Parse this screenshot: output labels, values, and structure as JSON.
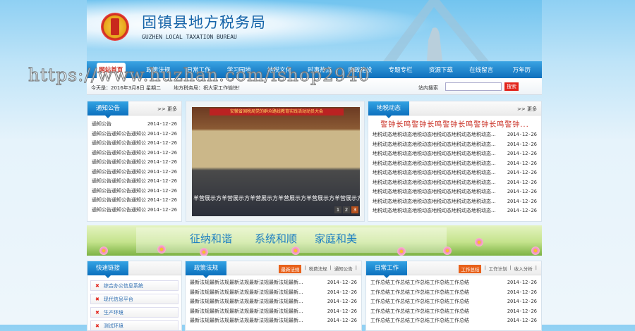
{
  "header": {
    "title": "固镇县地方税务局",
    "subtitle": "GUZHEN LOCAL TAXATION BUREAU"
  },
  "nav": [
    "网站首页",
    "政策法规",
    "日常工作",
    "学习园地",
    "地税文化",
    "时事热点",
    "廉政建设",
    "专题专栏",
    "资源下载",
    "在线留言",
    "万年历"
  ],
  "status": {
    "date": "今天是：2016年3月8日  星期二",
    "message": "地方税务局：祝大家工作愉快！",
    "search_label": "站内搜索",
    "search_value": "",
    "search_button": "搜索"
  },
  "watermark": "https://www.huzhan.com/ishop2940",
  "notice": {
    "title": "通知公告",
    "more": ">> 更多",
    "items": [
      {
        "t": "通知公告",
        "d": "2014-12-26"
      },
      {
        "t": "通知公告通知公告通知公",
        "d": "2014-12-26"
      },
      {
        "t": "通知公告通知公告通知公",
        "d": "2014-12-26"
      },
      {
        "t": "通知公告通知公告通知公",
        "d": "2014-12-26"
      },
      {
        "t": "通知公告通知公告通知公",
        "d": "2014-12-26"
      },
      {
        "t": "通知公告通知公告通知公",
        "d": "2014-12-26"
      },
      {
        "t": "通知公告通知公告通知公",
        "d": "2014-12-26"
      },
      {
        "t": "通知公告通知公告通知公",
        "d": "2014-12-26"
      },
      {
        "t": "通知公告通知公告通知公",
        "d": "2014-12-26"
      },
      {
        "t": "通知公告通知公告通知公",
        "d": "2014-12-26"
      }
    ]
  },
  "slideshow": {
    "banner": "安徽省国税局党的群众路线教育实践活动动员大会",
    "caption": "羊营展示方羊营展示方羊营展示方羊营展示方羊营展示方羊营展示方",
    "pages": [
      "1",
      "2",
      "3"
    ],
    "active": 3
  },
  "news": {
    "title": "地税动态",
    "more": ">> 更多",
    "headline": "警钟长鸣警钟长鸣警钟长鸣警钟长鸣警钟...",
    "items": [
      {
        "t": "地税动态地税动态地税动态地税动态地税动态地税动态...",
        "d": "2014-12-26"
      },
      {
        "t": "地税动态地税动态地税动态地税动态地税动态地税动态...",
        "d": "2014-12-26"
      },
      {
        "t": "地税动态地税动态地税动态地税动态地税动态地税动态...",
        "d": "2014-12-26"
      },
      {
        "t": "地税动态地税动态地税动态地税动态地税动态地税动态...",
        "d": "2014-12-26"
      },
      {
        "t": "地税动态地税动态地税动态地税动态地税动态地税动态...",
        "d": "2014-12-26"
      },
      {
        "t": "地税动态地税动态地税动态地税动态地税动态地税动态...",
        "d": "2014-12-26"
      },
      {
        "t": "地税动态地税动态地税动态地税动态地税动态地税动态...",
        "d": "2014-12-26"
      },
      {
        "t": "地税动态地税动态地税动态地税动态地税动态地税动态...",
        "d": "2014-12-26"
      },
      {
        "t": "地税动态地税动态地税动态地税动态地税动态地税动态...",
        "d": "2014-12-26"
      }
    ]
  },
  "banner": [
    "征纳和谐",
    "系统和顺",
    "家庭和美"
  ],
  "quicklinks": {
    "title": "快速链接",
    "items": [
      "综合办公信息系统",
      "现代信息平台",
      "生产环境",
      "测试环境"
    ]
  },
  "policy": {
    "title": "政策法规",
    "tabs": [
      "最新法规",
      "税费法规",
      "通知公告"
    ],
    "items": [
      {
        "t": "最新法规最新法规最新法规最新法规最新法规最新...",
        "d": "2014-12-26"
      },
      {
        "t": "最新法规最新法规最新法规最新法规最新法规最新...",
        "d": "2014-12-26"
      },
      {
        "t": "最新法规最新法规最新法规最新法规最新法规最新...",
        "d": "2014-12-26"
      },
      {
        "t": "最新法规最新法规最新法规最新法规最新法规最新...",
        "d": "2014-12-26"
      },
      {
        "t": "最新法规最新法规最新法规最新法规最新法规最新...",
        "d": "2014-12-26"
      }
    ]
  },
  "work": {
    "title": "日常工作",
    "tabs": [
      "工作总结",
      "工作计划",
      "收入分析"
    ],
    "items": [
      {
        "t": "工作总结工作总结工作总结工作总结工作总结",
        "d": "2014-12-26"
      },
      {
        "t": "工作总结工作总结工作总结工作总结工作总结",
        "d": "2014-12-26"
      },
      {
        "t": "工作总结工作总结工作总结工作总结工作总结",
        "d": "2014-12-26"
      },
      {
        "t": "工作总结工作总结工作总结工作总结工作总结",
        "d": "2014-12-26"
      },
      {
        "t": "工作总结工作总结工作总结工作总结工作总结",
        "d": "2014-12-26"
      }
    ]
  }
}
